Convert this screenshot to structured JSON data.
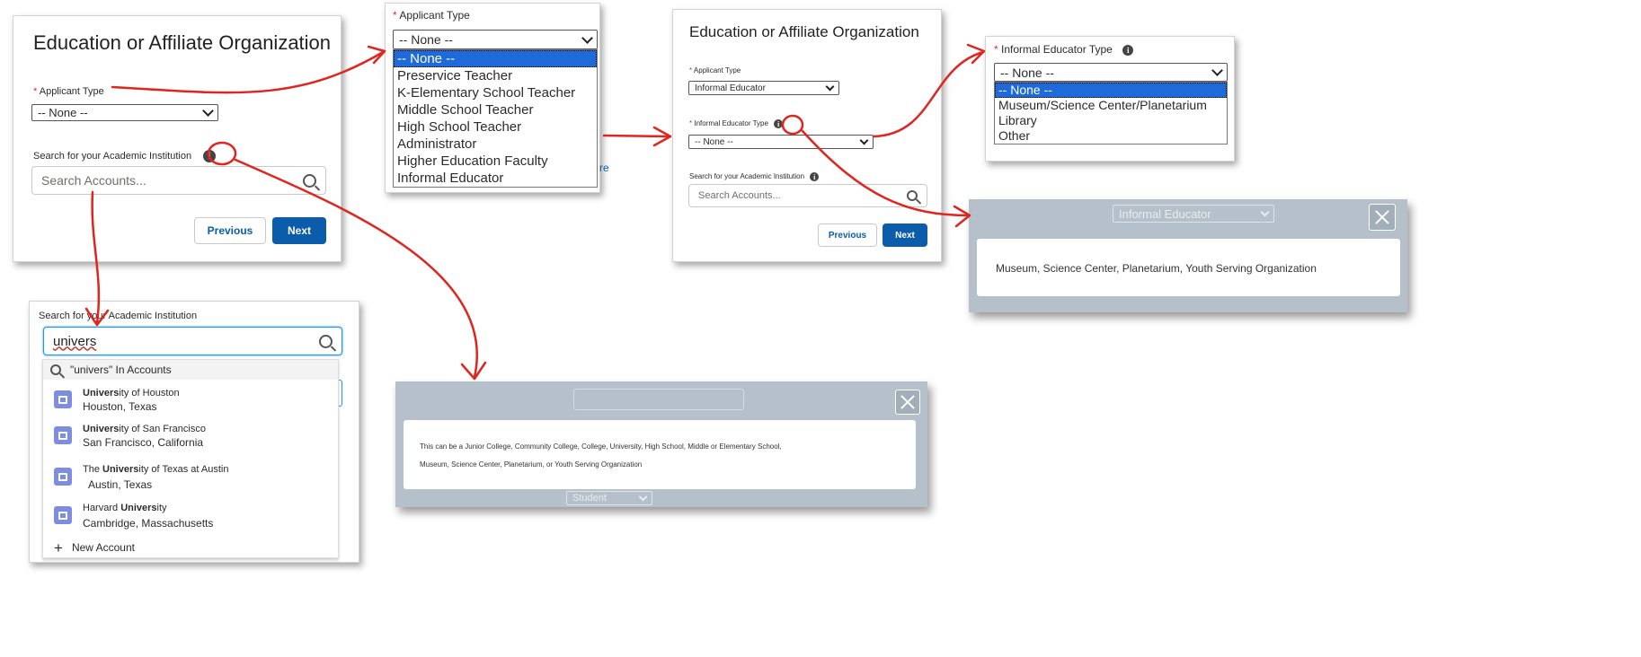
{
  "panel1": {
    "title": "Education or Affiliate Organization",
    "req_mark": "*",
    "applicant_type_label": "Applicant Type",
    "applicant_type_value": "-- None --",
    "search_label": "Search for your Academic Institution",
    "search_placeholder": "Search Accounts...",
    "previous": "Previous",
    "next": "Next"
  },
  "dropdown1": {
    "req_mark": "*",
    "label": "Applicant Type",
    "value": "-- None --",
    "options": [
      "-- None --",
      "Preservice Teacher",
      "K-Elementary School Teacher",
      "Middle School Teacher",
      "High School Teacher",
      "Administrator",
      "Higher Education Faculty",
      "Informal Educator"
    ],
    "peek_text": "re"
  },
  "panel2": {
    "title": "Education or Affiliate Organization",
    "req_mark": "*",
    "applicant_type_label": "Applicant Type",
    "applicant_type_value": "Informal Educator",
    "educator_type_label": "Informal Educator Type",
    "educator_type_value": "-- None --",
    "search_label": "Search for your Academic Institution",
    "search_placeholder": "Search Accounts...",
    "previous": "Previous",
    "next": "Next"
  },
  "dropdown2": {
    "req_mark": "*",
    "label": "Informal Educator Type",
    "value": "-- None --",
    "options": [
      "-- None --",
      "Museum/Science Center/Planetarium",
      "Library",
      "Other"
    ]
  },
  "modal_educator": {
    "bg_select": "Informal Educator",
    "text": "Museum, Science Center, Planetarium, Youth Serving Organization"
  },
  "search_panel": {
    "label": "Search for your Academic Institution",
    "query": "univers",
    "results_header": "\"univers\" In Accounts",
    "results": [
      {
        "pre": "",
        "bold": "Univers",
        "post": "ity of Houston",
        "sub": "Houston, Texas"
      },
      {
        "pre": "",
        "bold": "Univers",
        "post": "ity of San Francisco",
        "sub": "San Francisco, California"
      },
      {
        "pre": "The ",
        "bold": "Univers",
        "post": "ity of Texas at Austin",
        "sub": "Austin, Texas"
      },
      {
        "pre": "Harvard ",
        "bold": "Univers",
        "post": "ity",
        "sub": "Cambridge, Massachusetts"
      }
    ],
    "new_account": "New Account"
  },
  "modal_institution": {
    "text_line1": "This can be a Junior College, Community College, College, University, High School, Middle or Elementary School,",
    "text_line2": "Museum, Science Center, Planetarium, or Youth Serving Organization",
    "bg_select": "Student"
  },
  "colors": {
    "annotation": "#e0251f",
    "brand": "#0b5cab",
    "highlight": "#1e6ad8",
    "modal_bg": "#b6c0cb"
  }
}
